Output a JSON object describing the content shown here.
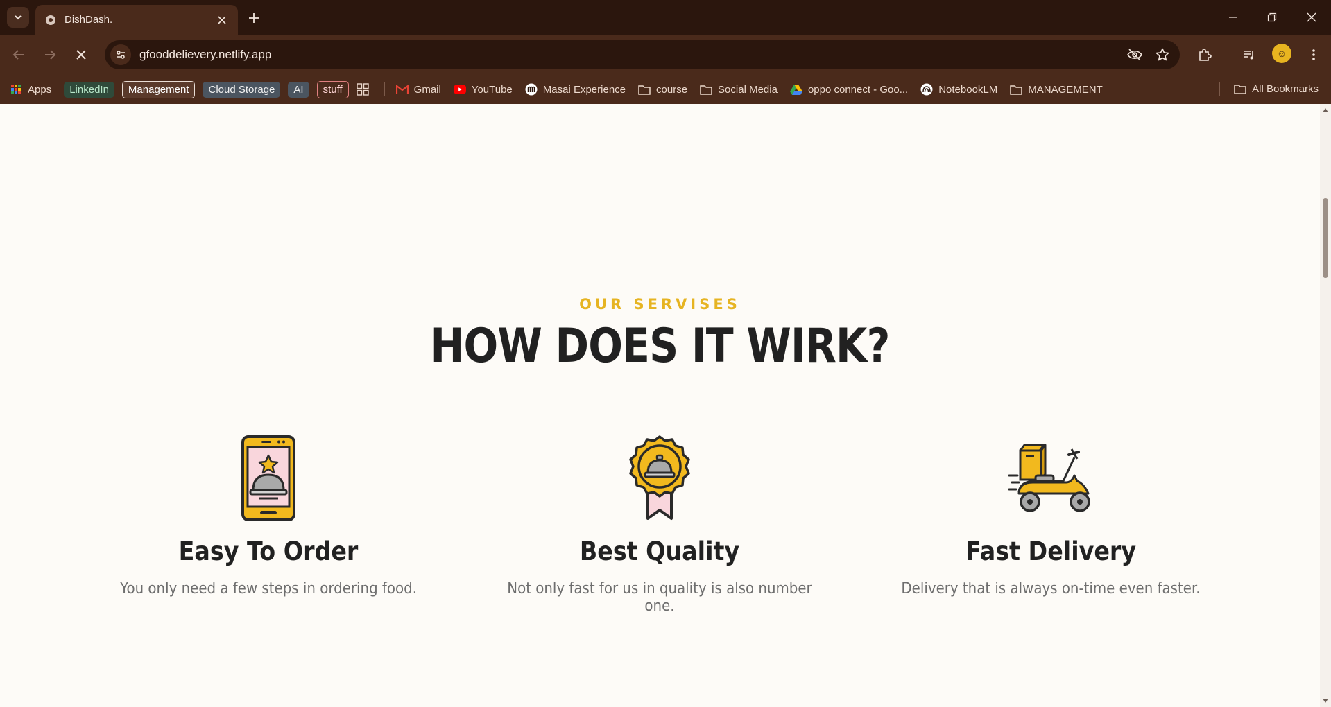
{
  "browser": {
    "tab_title": "DishDash.",
    "url": "gfooddelievery.netlify.app",
    "bookmarks": {
      "apps": "Apps",
      "linkedin": "LinkedIn",
      "management": "Management",
      "cloud_storage": "Cloud Storage",
      "ai": "AI",
      "stuff": "stuff",
      "gmail": "Gmail",
      "youtube": "YouTube",
      "masai": "Masai Experience",
      "course": "course",
      "social_media": "Social Media",
      "oppo": "oppo connect - Goo...",
      "notebooklm": "NotebookLM",
      "management_folder": "MANAGEMENT",
      "all_bookmarks": "All Bookmarks"
    },
    "accent_color": "#4a2a1b"
  },
  "section": {
    "eyebrow": "OUR SERVISES",
    "title": "HOW DOES IT WIRK?",
    "cards": [
      {
        "icon": "phone-order-icon",
        "title": "Easy To Order",
        "description": "You only need a few steps in ordering food."
      },
      {
        "icon": "quality-badge-icon",
        "title": "Best Quality",
        "description": "Not only fast for us in quality is also number one."
      },
      {
        "icon": "delivery-scooter-icon",
        "title": "Fast Delivery",
        "description": "Delivery that is always on-time even faster."
      }
    ],
    "accent_color": "#e6b422"
  }
}
